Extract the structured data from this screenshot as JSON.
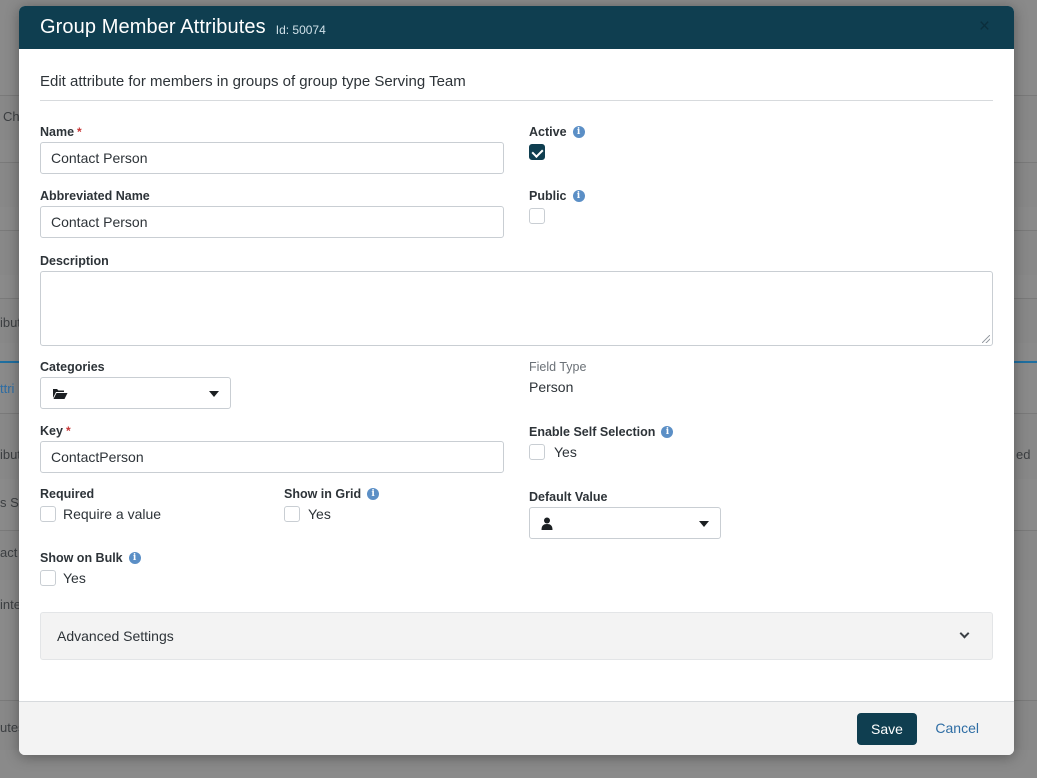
{
  "background": {
    "fragments": [
      "Ch",
      "ibut",
      "ttri",
      "ibute",
      "ed",
      "s S",
      "act",
      "inte",
      "utes"
    ]
  },
  "modal": {
    "title": "Group Member Attributes",
    "id_label": "Id: 50074",
    "close_glyph": "×",
    "subheading": "Edit attribute for members in groups of group type Serving Team"
  },
  "form": {
    "name": {
      "label": "Name",
      "required_mark": "*",
      "value": "Contact Person"
    },
    "active": {
      "label": "Active",
      "checked": true
    },
    "abbreviated_name": {
      "label": "Abbreviated Name",
      "value": "Contact Person"
    },
    "public": {
      "label": "Public",
      "checked": false
    },
    "description": {
      "label": "Description",
      "value": ""
    },
    "categories": {
      "label": "Categories",
      "icon": "folder-open-icon"
    },
    "field_type": {
      "label": "Field Type",
      "value": "Person"
    },
    "key": {
      "label": "Key",
      "required_mark": "*",
      "value": "ContactPerson"
    },
    "enable_self_selection": {
      "label": "Enable Self Selection",
      "option": "Yes",
      "checked": false
    },
    "required": {
      "label": "Required",
      "option": "Require a value",
      "checked": false
    },
    "show_in_grid": {
      "label": "Show in Grid",
      "option": "Yes",
      "checked": false
    },
    "default_value": {
      "label": "Default Value",
      "icon": "person-icon"
    },
    "show_on_bulk": {
      "label": "Show on Bulk",
      "option": "Yes",
      "checked": false
    },
    "info_glyph": "i"
  },
  "advanced": {
    "label": "Advanced Settings"
  },
  "footer": {
    "save_label": "Save",
    "cancel_label": "Cancel"
  },
  "colors": {
    "header": "#0f3e50",
    "primary": "#0f3e50",
    "link": "#2e6da4",
    "required": "#c73636",
    "info": "#5b8fc6"
  }
}
